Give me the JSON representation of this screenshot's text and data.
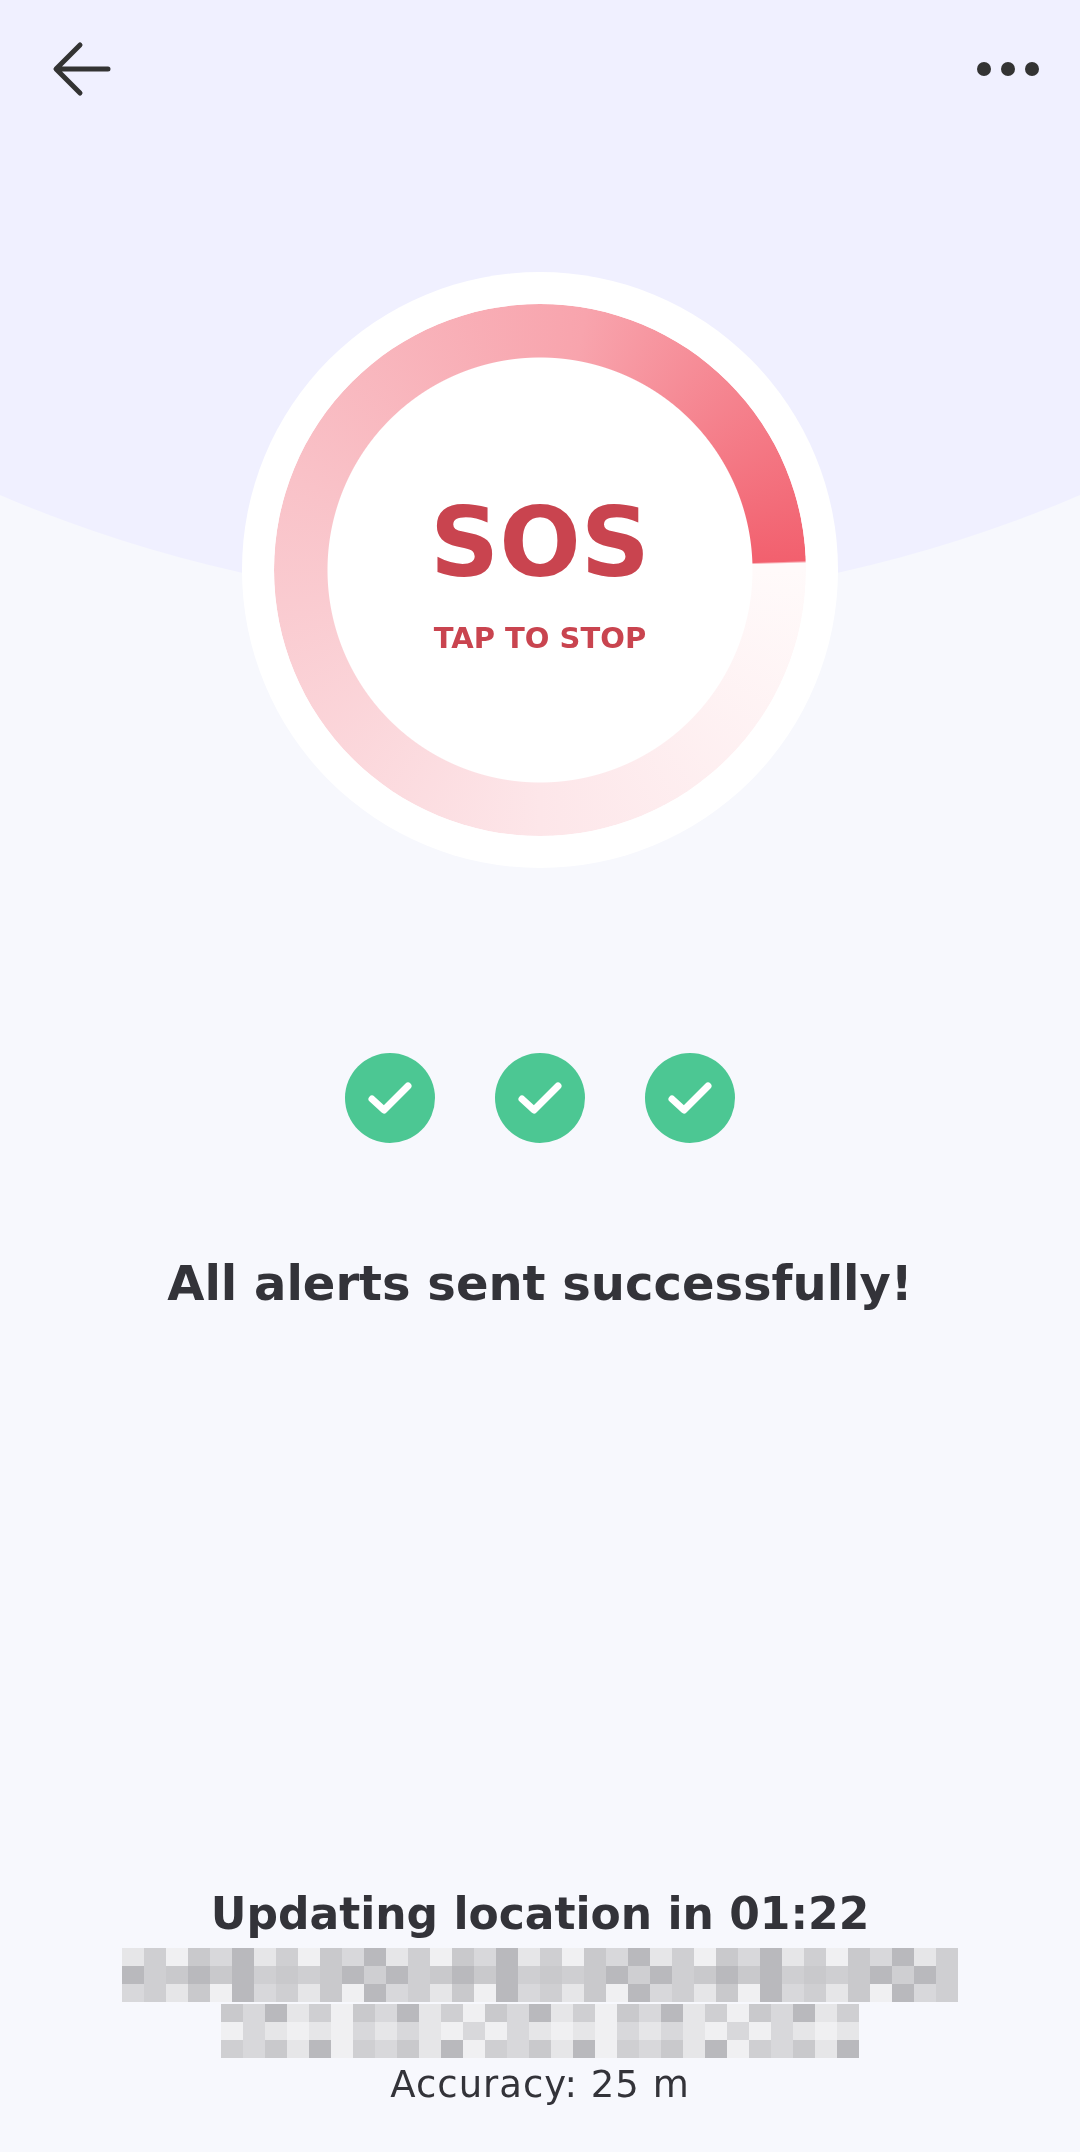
{
  "sos": {
    "title": "SOS",
    "action": "TAP TO STOP"
  },
  "alerts": [
    {
      "sent": true
    },
    {
      "sent": true
    },
    {
      "sent": true
    }
  ],
  "status_message": "All alerts sent successfully!",
  "location": {
    "countdown": "Updating location in 01:22",
    "accuracy": "Accuracy: 25 m"
  }
}
